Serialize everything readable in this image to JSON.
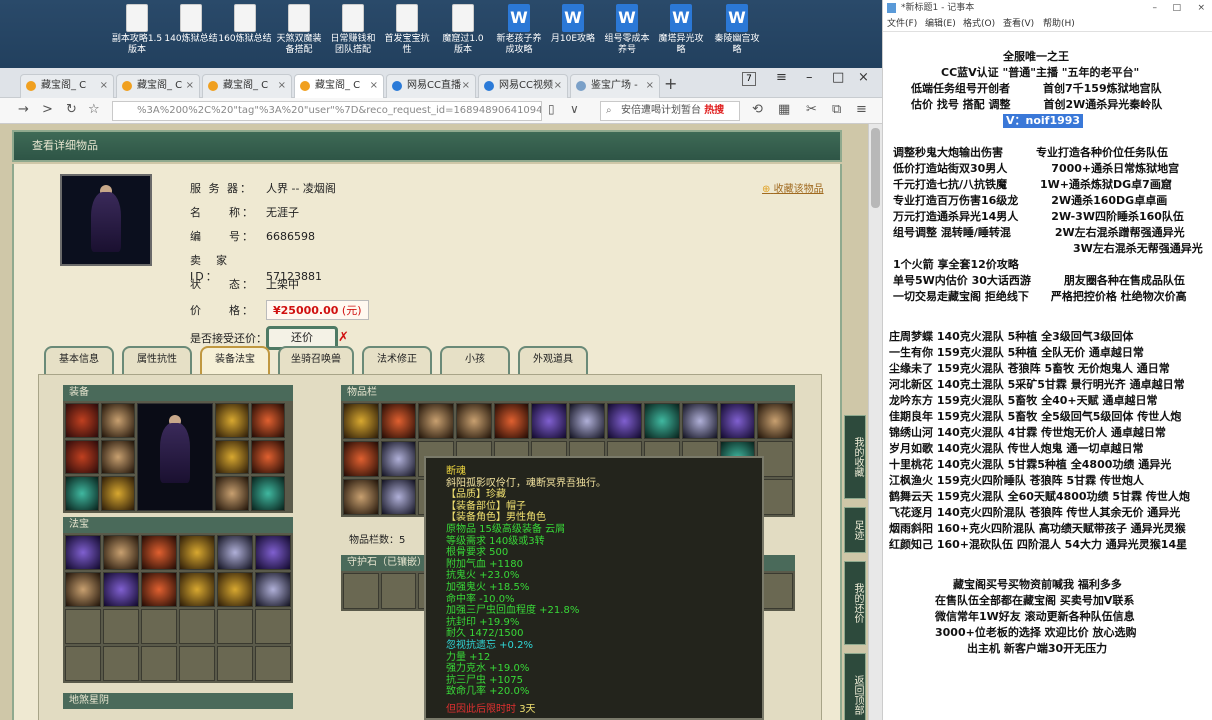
{
  "desktop": {
    "icons": [
      {
        "label": "副本攻略1.5\n版本",
        "type": "file"
      },
      {
        "label": "140炼狱总结",
        "type": "file"
      },
      {
        "label": "160炼狱总结",
        "type": "file"
      },
      {
        "label": "天煞双魔装\n备搭配",
        "type": "file"
      },
      {
        "label": "日常赚钱和\n团队搭配",
        "type": "file"
      },
      {
        "label": "首发宝宝抗\n性",
        "type": "file"
      },
      {
        "label": "魔窟过1.0\n版本",
        "type": "file"
      },
      {
        "label": "新老孩子养\n成攻略",
        "type": "word"
      },
      {
        "label": "月10E攻略",
        "type": "word"
      },
      {
        "label": "组号零成本\n养号",
        "type": "word"
      },
      {
        "label": "魔塔异光攻\n略",
        "type": "word"
      },
      {
        "label": "秦陵幽宫攻\n略",
        "type": "word"
      }
    ]
  },
  "browser": {
    "tabs": [
      {
        "label": "藏宝阁_ C"
      },
      {
        "label": "藏宝阁_ C"
      },
      {
        "label": "藏宝阁_ C"
      },
      {
        "label": "藏宝阁_ C"
      },
      {
        "label": "网易CC直播"
      },
      {
        "label": "网易CC视频"
      },
      {
        "label": "鉴宝广场 -"
      }
    ],
    "tab_count": "7",
    "url": "%3A%200%2C%20\"tag\"%3A%20\"user\"%7D&reco_request_id=16894890641094Xdl5",
    "search_text": "安倍遭喝计划暂台",
    "search_badge": "热搜"
  },
  "panel": {
    "title": "查看详细物品"
  },
  "item_info": {
    "server_label": "服 务 器：",
    "server_value": "人界 -- 凌烟阁",
    "name_label": "名　　称：",
    "name_value": "无涯子",
    "id_label": "编　　号：",
    "id_value": "6686598",
    "seller_label": "卖　家　ID：",
    "seller_value": "57123881",
    "status_label": "状　　态：",
    "status_value": "上架中",
    "price_label": "价　　格：",
    "price_value": "¥25000.00",
    "price_unit": "(元)",
    "counter_label": "是否接受还价：",
    "counter_button": "还价",
    "favorite": "收藏该物品"
  },
  "tabs": [
    "基本信息",
    "属性抗性",
    "装备法宝",
    "坐骑召唤兽",
    "法术修正",
    "小孩",
    "外观道具"
  ],
  "active_tab": "装备法宝",
  "sections": {
    "equip": "装备",
    "treasure": "法宝",
    "inventory": "物品栏",
    "guard": "守护石（已镶嵌）",
    "earth": "地煞星阴"
  },
  "inventory_count": "物品栏数：5",
  "tooltip": {
    "name": "断魂",
    "desc": "斜阳孤影叹伶仃，魂断冥界吾独行。",
    "lines_yellow": [
      "【品质】珍藏",
      "【装备部位】帽子",
      "【装备角色】男性角色"
    ],
    "lines_green": [
      "原物品 15级高级装备 云屑",
      "等级需求 140级或3转",
      "根骨要求 500",
      "附加气血 +1180",
      "抗鬼火 +23.0%",
      "加强鬼火 +18.5%",
      "命中率 -10.0%",
      "加强三尸虫回血程度 +21.8%",
      "抗封印 +19.9%",
      "耐久 1472/1500"
    ],
    "line_cyan": "忽视抗遗忘 +0.2%",
    "lines_green2": [
      "力量 +12",
      "强力克水 +19.0%",
      "抗三尸虫 +1075",
      "致命几率 +20.0%"
    ],
    "footer": "3天",
    "footer_prefix": "但因此后限时时"
  },
  "side_buttons": [
    "我的收藏",
    "足迹",
    "我的还价",
    "返回顶部"
  ],
  "notepad": {
    "title": "*新标题1 - 记事本",
    "menu": [
      "文件(F)",
      "编辑(E)",
      "格式(O)",
      "查看(V)",
      "帮助(H)"
    ],
    "lines": [
      "全服唯一之王",
      "CC蓝V认证 \"普通\"主播 \"五年的老平台\"",
      "低端任务组号开创者　　　首创7千159炼狱地宫队",
      "估价 找号 搭配 调整　　　首创2W通杀异光秦岭队",
      "V：noif1993",
      "调整秒鬼大炮输出伤害　　　专业打造各种价位任务队伍",
      "低价打造站街双30男人　　　　7000+通杀日常炼狱地宫",
      "千元打造七抗/八抗铁魔　　　1W+通杀炼狱DG卓7画窟",
      "专业打造百万伤害16级龙　　　2W通杀160DG卓卓画",
      "万元打造通杀异光14男人　　　2W-3W四阶睡杀160队伍",
      "组号调整 混转睡/睡转混　　　　2W左右混杀蹭帮强通异光",
      "3W左右混杀无帮强通异光",
      "1个火箭 享全套12价攻略",
      "单号5W内估价 30大话西游　　　朋友圈各种在售成品队伍",
      "一切交易走藏宝阁 拒绝线下　　严格把控价格 杜绝物次价高",
      "庄周梦蝶 140克火混队 5种植 全3级回气3级回体",
      "一生有你 159克火混队 5种植 全队无价 通卓越日常",
      "尘缘未了 159克火混队 苍狼阵 5畜牧 无价炮鬼人 通日常",
      "河北新区 140克土混队 5采矿5甘霖 景行明光齐 通卓越日常",
      "龙吟东方 159克火混队 5畜牧 全40+天赋 通卓越日常",
      "佳期良年 159克火混队 5畜牧 全5级回气5级回体 传世人炮",
      "锦绣山河 140克火混队 4甘霖 传世炮无价人 通卓越日常",
      "岁月如歌 140克火混队 传世人炮鬼 通一切卓越日常",
      "十里桃花 140克火混队 5甘霖5种植 全4800功绩 通异光",
      "江枫渔火 159克火四阶睡队 苍狼阵 5甘霖 传世炮人",
      "鹤舞云天 159克火混队 全60天赋4800功绩 5甘霖 传世人炮",
      "飞花逐月 140克火四阶混队 苍狼阵 传世人其余无价 通异光",
      "烟雨斜阳 160+克火四阶混队 高功绩天赋带孩子 通异光灵猴",
      "红颜知己 160+混砍队伍 四阶混人 54大力 通异光灵猴14星",
      "藏宝阁买号买物资前喊我 福利多多",
      "在售队伍全部都在藏宝阁 买卖号加V联系",
      "微信常年1W好友 滚动更新各种队伍信息",
      "3000+位老板的选择 欢迎比价 放心选购",
      "出主机 新客户端30开无压力"
    ]
  }
}
